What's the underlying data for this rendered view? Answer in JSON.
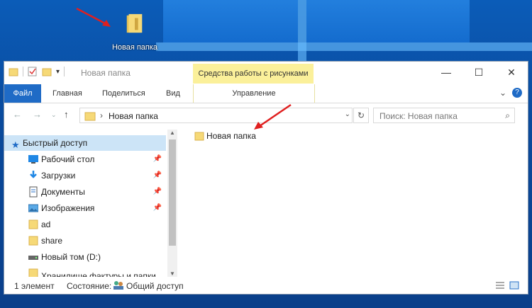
{
  "desktop": {
    "icon_label": "Новая папка"
  },
  "window": {
    "title": "Новая папка",
    "context_tab": "Средства работы с рисунками"
  },
  "ribbon": {
    "tabs": [
      "Файл",
      "Главная",
      "Поделиться",
      "Вид",
      "Управление"
    ]
  },
  "address": {
    "path": "Новая папка"
  },
  "search": {
    "placeholder": "Поиск: Новая папка"
  },
  "navigation": {
    "items": [
      {
        "label": "Быстрый доступ",
        "icon": "star-icon",
        "pinned": false
      },
      {
        "label": "Рабочий стол",
        "icon": "desktop-icon",
        "pinned": true
      },
      {
        "label": "Загрузки",
        "icon": "download-icon",
        "pinned": true
      },
      {
        "label": "Документы",
        "icon": "documents-icon",
        "pinned": true
      },
      {
        "label": "Изображения",
        "icon": "pictures-icon",
        "pinned": true
      },
      {
        "label": "ad",
        "icon": "folder-icon",
        "pinned": false
      },
      {
        "label": "share",
        "icon": "folder-icon",
        "pinned": false
      },
      {
        "label": "Новый том (D:)",
        "icon": "drive-icon",
        "pinned": false
      },
      {
        "label": "Хранилище фактуры и папки",
        "icon": "folder-icon",
        "pinned": false
      }
    ]
  },
  "content": {
    "items": [
      {
        "name": "Новая папка"
      }
    ]
  },
  "status": {
    "count": "1 элемент",
    "state_label": "Состояние:",
    "share": "Общий доступ"
  },
  "colors": {
    "accent": "#1f6bc6",
    "context": "#fbf09a",
    "selection": "#cce4f7",
    "arrow": "#e02020"
  }
}
